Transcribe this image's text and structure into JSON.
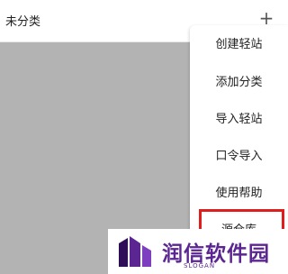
{
  "header": {
    "title": "未分类",
    "add_label": "+"
  },
  "menu": {
    "items": [
      {
        "label": "创建轻站"
      },
      {
        "label": "添加分类"
      },
      {
        "label": "导入轻站"
      },
      {
        "label": "口令导入"
      },
      {
        "label": "使用帮助"
      },
      {
        "label": "源仓库"
      }
    ]
  },
  "watermark": {
    "brand": "润信软件园",
    "slogan": "SLOGAN"
  },
  "colors": {
    "overlay": "#b3b3b3",
    "highlight": "#e01d1d",
    "brand": "#5b2691"
  }
}
